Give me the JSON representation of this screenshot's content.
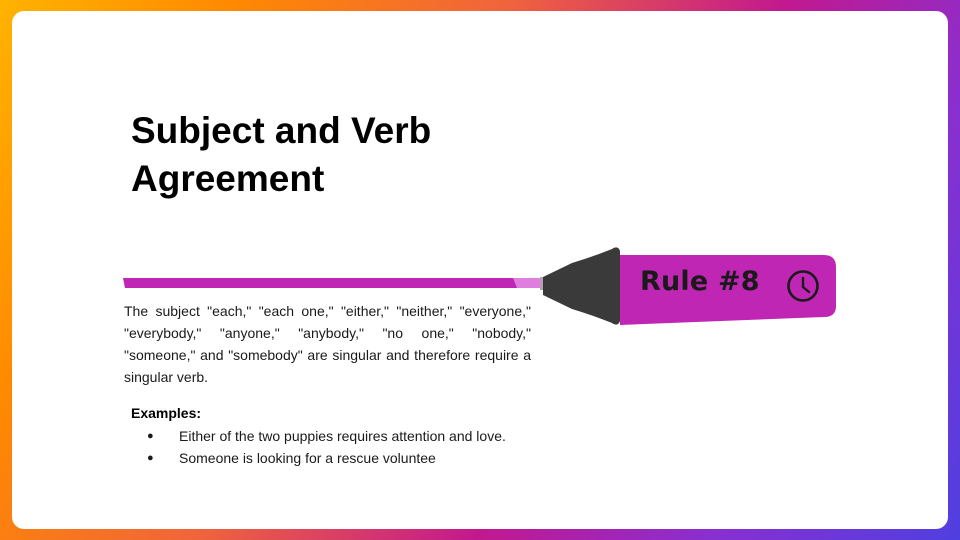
{
  "slide": {
    "title": "Subject and Verb Agreement",
    "rule_label": "Rule #8",
    "rule_icon": "clock-icon",
    "body": "The subject \"each,\" \"each one,\" \"either,\" \"neither,\" \"everyone,\" \"everybody,\" \"anyone,\" \"anybody,\" \"no one,\" \"nobody,\" \"someone,\" and \"somebody\" are singular and therefore require a singular verb.",
    "examples_label": "Examples:",
    "examples": [
      "Either of the two puppies requires attention and love.",
      "Someone is looking for a rescue voluntee"
    ]
  },
  "colors": {
    "highlighter_body": "#c026b4",
    "highlighter_tip": "#3a3a3a",
    "highlighter_light": "#e07ee0"
  }
}
